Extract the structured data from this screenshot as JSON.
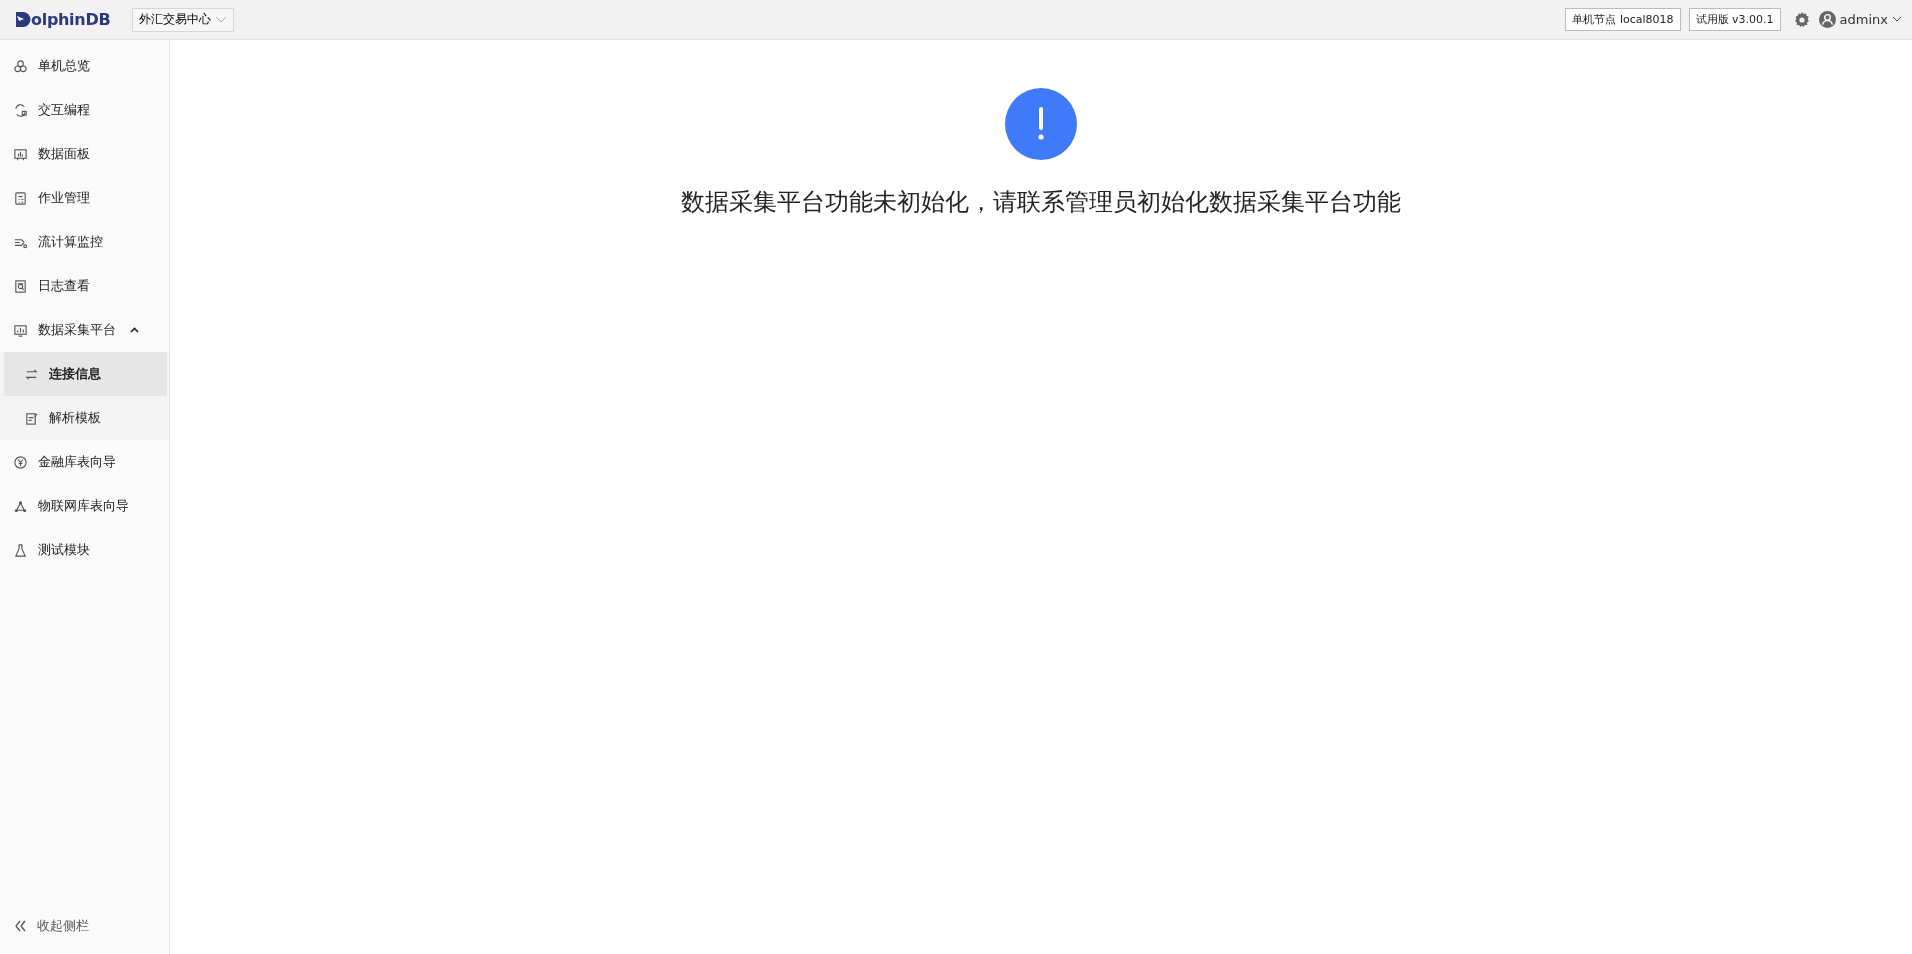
{
  "header": {
    "logo_text": "olphinDB",
    "cluster_select": {
      "value": "外汇交易中心"
    },
    "node_badge": "单机节点 local8018",
    "version_badge": "试用版 v3.00.1",
    "user": "adminx"
  },
  "sidebar": {
    "items": [
      {
        "label": "单机总览",
        "selected": false
      },
      {
        "label": "交互编程",
        "selected": false
      },
      {
        "label": "数据面板",
        "selected": false
      },
      {
        "label": "作业管理",
        "selected": false
      },
      {
        "label": "流计算监控",
        "selected": false
      },
      {
        "label": "日志查看",
        "selected": false
      },
      {
        "label": "数据采集平台",
        "selected": false,
        "expanded": true,
        "children": [
          {
            "label": "连接信息",
            "selected": true
          },
          {
            "label": "解析模板",
            "selected": false
          }
        ]
      },
      {
        "label": "金融库表向导",
        "selected": false
      },
      {
        "label": "物联网库表向导",
        "selected": false
      },
      {
        "label": "测试模块",
        "selected": false
      }
    ],
    "collapse_label": "收起侧栏"
  },
  "main": {
    "message": "数据采集平台功能未初始化，请联系管理员初始化数据采集平台功能"
  }
}
